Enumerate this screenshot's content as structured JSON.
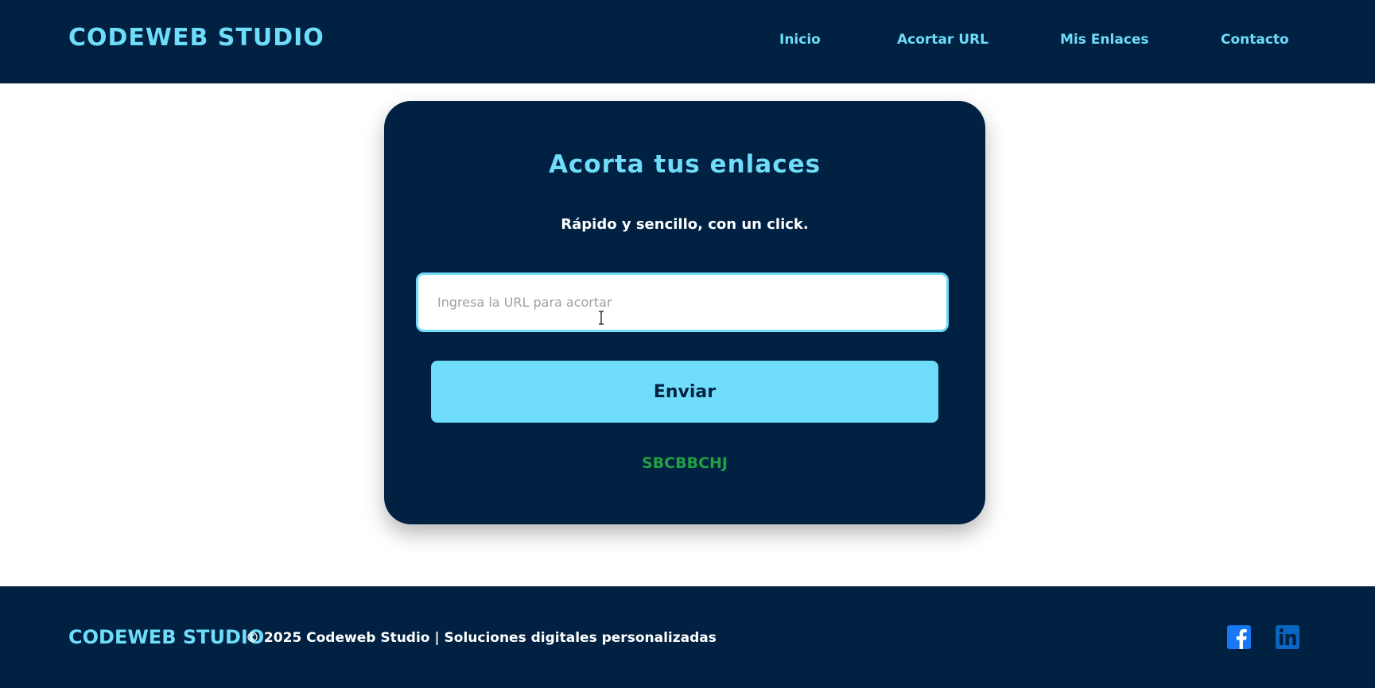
{
  "header": {
    "brand": "CODEWEB STUDIO",
    "nav": [
      {
        "label": "Inicio"
      },
      {
        "label": "Acortar URL"
      },
      {
        "label": "Mis Enlaces"
      },
      {
        "label": "Contacto"
      }
    ]
  },
  "main": {
    "title": "Acorta tus enlaces",
    "subtitle": "Rápido y sencillo, con un click.",
    "input": {
      "value": "",
      "placeholder": "Ingresa la URL para acortar"
    },
    "submit_label": "Enviar",
    "result_code": "SBCBBCHJ"
  },
  "footer": {
    "brand": "CODEWEB STUDIO",
    "copyright": "© 2025 Codeweb Studio | Soluciones digitales personalizadas",
    "social": [
      {
        "icon": "facebook-icon",
        "color": "#1877f2"
      },
      {
        "icon": "linkedin-icon",
        "color": "#0a66c2"
      }
    ]
  },
  "colors": {
    "navy": "#002142",
    "accent": "#6fdcf9",
    "success": "#22a045"
  }
}
